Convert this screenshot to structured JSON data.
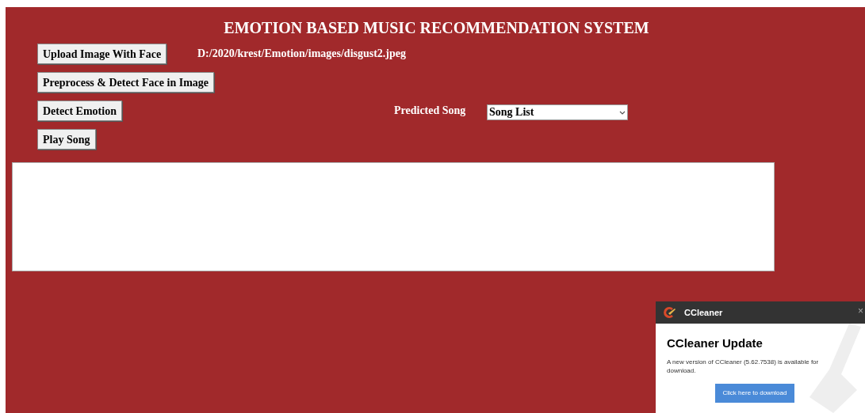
{
  "window": {
    "title": "EMOTION BASED MUSIC RECOMMENDATION SYSTEM"
  },
  "buttons": [
    "Upload Image With Face",
    "Preprocess & Detect Face in Image",
    "Detect Emotion",
    "Play Song"
  ],
  "file_path": "D:/2020/krest/Emotion/images/disgust2.jpeg",
  "predicted_song": {
    "label": "Predicted Song",
    "value": "Song List"
  },
  "notification": {
    "app": "CCleaner",
    "close": "×",
    "title": "CCleaner Update",
    "message": "A new version of CCleaner (5.62.7538) is available for download.",
    "button": "Click here to download"
  }
}
